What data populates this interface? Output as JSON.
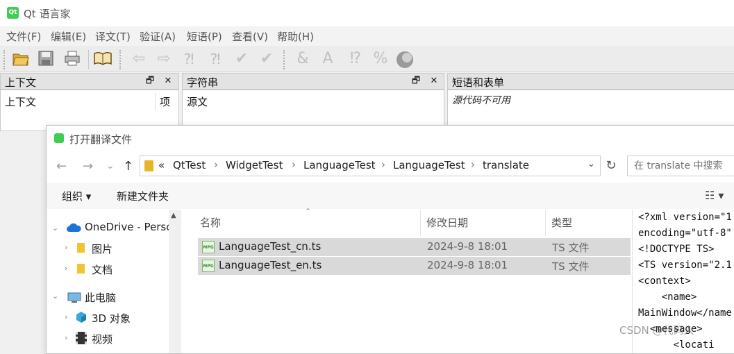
{
  "app": {
    "logo_text": "Qt",
    "title": "Qt 语言家"
  },
  "menu": [
    "文件(F)",
    "编辑(E)",
    "译文(T)",
    "验证(A)",
    "短语(P)",
    "查看(V)",
    "帮助(H)"
  ],
  "toolbar_icons": [
    "open-icon",
    "save-icon",
    "print-icon",
    "phrasebook-icon",
    "prev-icon",
    "next-icon",
    "prev-unfinished-icon",
    "next-unfinished-icon",
    "done-icon",
    "done-next-icon",
    "accelerator-icon",
    "punctuation-icon",
    "phrase-match-icon",
    "place-marker-icon",
    "surrounding-whitespace-icon"
  ],
  "panels": {
    "context": {
      "title": "上下文",
      "col_context": "上下文",
      "col_items": "项"
    },
    "strings": {
      "title": "字符串",
      "col_source": "源文"
    },
    "phrases": {
      "title": "短语和表单",
      "message": "源代码不可用"
    },
    "float_btn": "🗗",
    "close_btn": "✕"
  },
  "dialog": {
    "title": "打开翻译文件",
    "nav": {
      "back": "←",
      "forward": "→",
      "recent": "⌄",
      "up": "↑"
    },
    "breadcrumb": [
      "«",
      "QtTest",
      "WidgetTest",
      "LanguageTest",
      "LanguageTest",
      "translate"
    ],
    "crumb_sep": "›",
    "search_placeholder": "在 translate 中搜索",
    "commands": {
      "organize": "组织 ▾",
      "new_folder": "新建文件夹"
    },
    "nav_tree": [
      {
        "label": "OneDrive - Perso",
        "icon": "onedrive-icon"
      },
      {
        "label": "图片",
        "icon": "folder-icon"
      },
      {
        "label": "文档",
        "icon": "folder-icon"
      },
      {
        "label": "此电脑",
        "icon": "computer-icon"
      },
      {
        "label": "3D 对象",
        "icon": "3d-objects-icon"
      },
      {
        "label": "视频",
        "icon": "video-icon"
      }
    ],
    "columns": {
      "name": "名称",
      "modified": "修改日期",
      "type": "类型"
    },
    "files": [
      {
        "name": "LanguageTest_cn.ts",
        "modified": "2024-9-8 18:01",
        "type": "TS 文件",
        "icon_label": "MPG"
      },
      {
        "name": "LanguageTest_en.ts",
        "modified": "2024-9-8 18:01",
        "type": "TS 文件",
        "icon_label": "MPG"
      }
    ],
    "preview_lines": [
      "<?xml version=\"1",
      "encoding=\"utf-8\"",
      "<!DOCTYPE TS>",
      "<TS version=\"2.1",
      "<context>",
      "    <name>",
      "MainWindow</name",
      "  <message>",
      "      <locati"
    ]
  },
  "watermark": "CSDN @代码人"
}
